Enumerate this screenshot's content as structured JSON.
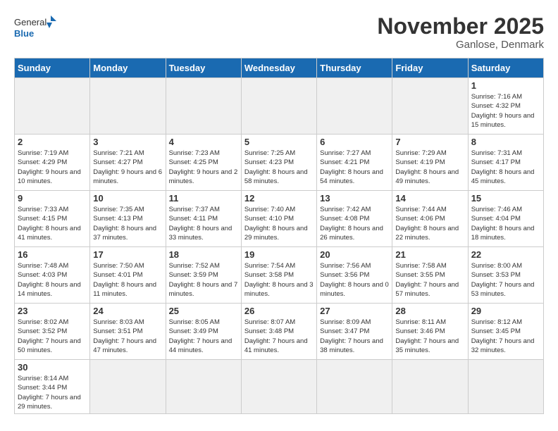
{
  "header": {
    "logo_general": "General",
    "logo_blue": "Blue",
    "month_title": "November 2025",
    "location": "Ganlose, Denmark"
  },
  "days_of_week": [
    "Sunday",
    "Monday",
    "Tuesday",
    "Wednesday",
    "Thursday",
    "Friday",
    "Saturday"
  ],
  "weeks": [
    [
      {
        "day": "",
        "info": ""
      },
      {
        "day": "",
        "info": ""
      },
      {
        "day": "",
        "info": ""
      },
      {
        "day": "",
        "info": ""
      },
      {
        "day": "",
        "info": ""
      },
      {
        "day": "",
        "info": ""
      },
      {
        "day": "1",
        "info": "Sunrise: 7:16 AM\nSunset: 4:32 PM\nDaylight: 9 hours\nand 15 minutes."
      }
    ],
    [
      {
        "day": "2",
        "info": "Sunrise: 7:19 AM\nSunset: 4:29 PM\nDaylight: 9 hours\nand 10 minutes."
      },
      {
        "day": "3",
        "info": "Sunrise: 7:21 AM\nSunset: 4:27 PM\nDaylight: 9 hours\nand 6 minutes."
      },
      {
        "day": "4",
        "info": "Sunrise: 7:23 AM\nSunset: 4:25 PM\nDaylight: 9 hours\nand 2 minutes."
      },
      {
        "day": "5",
        "info": "Sunrise: 7:25 AM\nSunset: 4:23 PM\nDaylight: 8 hours\nand 58 minutes."
      },
      {
        "day": "6",
        "info": "Sunrise: 7:27 AM\nSunset: 4:21 PM\nDaylight: 8 hours\nand 54 minutes."
      },
      {
        "day": "7",
        "info": "Sunrise: 7:29 AM\nSunset: 4:19 PM\nDaylight: 8 hours\nand 49 minutes."
      },
      {
        "day": "8",
        "info": "Sunrise: 7:31 AM\nSunset: 4:17 PM\nDaylight: 8 hours\nand 45 minutes."
      }
    ],
    [
      {
        "day": "9",
        "info": "Sunrise: 7:33 AM\nSunset: 4:15 PM\nDaylight: 8 hours\nand 41 minutes."
      },
      {
        "day": "10",
        "info": "Sunrise: 7:35 AM\nSunset: 4:13 PM\nDaylight: 8 hours\nand 37 minutes."
      },
      {
        "day": "11",
        "info": "Sunrise: 7:37 AM\nSunset: 4:11 PM\nDaylight: 8 hours\nand 33 minutes."
      },
      {
        "day": "12",
        "info": "Sunrise: 7:40 AM\nSunset: 4:10 PM\nDaylight: 8 hours\nand 29 minutes."
      },
      {
        "day": "13",
        "info": "Sunrise: 7:42 AM\nSunset: 4:08 PM\nDaylight: 8 hours\nand 26 minutes."
      },
      {
        "day": "14",
        "info": "Sunrise: 7:44 AM\nSunset: 4:06 PM\nDaylight: 8 hours\nand 22 minutes."
      },
      {
        "day": "15",
        "info": "Sunrise: 7:46 AM\nSunset: 4:04 PM\nDaylight: 8 hours\nand 18 minutes."
      }
    ],
    [
      {
        "day": "16",
        "info": "Sunrise: 7:48 AM\nSunset: 4:03 PM\nDaylight: 8 hours\nand 14 minutes."
      },
      {
        "day": "17",
        "info": "Sunrise: 7:50 AM\nSunset: 4:01 PM\nDaylight: 8 hours\nand 11 minutes."
      },
      {
        "day": "18",
        "info": "Sunrise: 7:52 AM\nSunset: 3:59 PM\nDaylight: 8 hours\nand 7 minutes."
      },
      {
        "day": "19",
        "info": "Sunrise: 7:54 AM\nSunset: 3:58 PM\nDaylight: 8 hours\nand 3 minutes."
      },
      {
        "day": "20",
        "info": "Sunrise: 7:56 AM\nSunset: 3:56 PM\nDaylight: 8 hours\nand 0 minutes."
      },
      {
        "day": "21",
        "info": "Sunrise: 7:58 AM\nSunset: 3:55 PM\nDaylight: 7 hours\nand 57 minutes."
      },
      {
        "day": "22",
        "info": "Sunrise: 8:00 AM\nSunset: 3:53 PM\nDaylight: 7 hours\nand 53 minutes."
      }
    ],
    [
      {
        "day": "23",
        "info": "Sunrise: 8:02 AM\nSunset: 3:52 PM\nDaylight: 7 hours\nand 50 minutes."
      },
      {
        "day": "24",
        "info": "Sunrise: 8:03 AM\nSunset: 3:51 PM\nDaylight: 7 hours\nand 47 minutes."
      },
      {
        "day": "25",
        "info": "Sunrise: 8:05 AM\nSunset: 3:49 PM\nDaylight: 7 hours\nand 44 minutes."
      },
      {
        "day": "26",
        "info": "Sunrise: 8:07 AM\nSunset: 3:48 PM\nDaylight: 7 hours\nand 41 minutes."
      },
      {
        "day": "27",
        "info": "Sunrise: 8:09 AM\nSunset: 3:47 PM\nDaylight: 7 hours\nand 38 minutes."
      },
      {
        "day": "28",
        "info": "Sunrise: 8:11 AM\nSunset: 3:46 PM\nDaylight: 7 hours\nand 35 minutes."
      },
      {
        "day": "29",
        "info": "Sunrise: 8:12 AM\nSunset: 3:45 PM\nDaylight: 7 hours\nand 32 minutes."
      }
    ],
    [
      {
        "day": "30",
        "info": "Sunrise: 8:14 AM\nSunset: 3:44 PM\nDaylight: 7 hours\nand 29 minutes."
      },
      {
        "day": "",
        "info": ""
      },
      {
        "day": "",
        "info": ""
      },
      {
        "day": "",
        "info": ""
      },
      {
        "day": "",
        "info": ""
      },
      {
        "day": "",
        "info": ""
      },
      {
        "day": "",
        "info": ""
      }
    ]
  ]
}
